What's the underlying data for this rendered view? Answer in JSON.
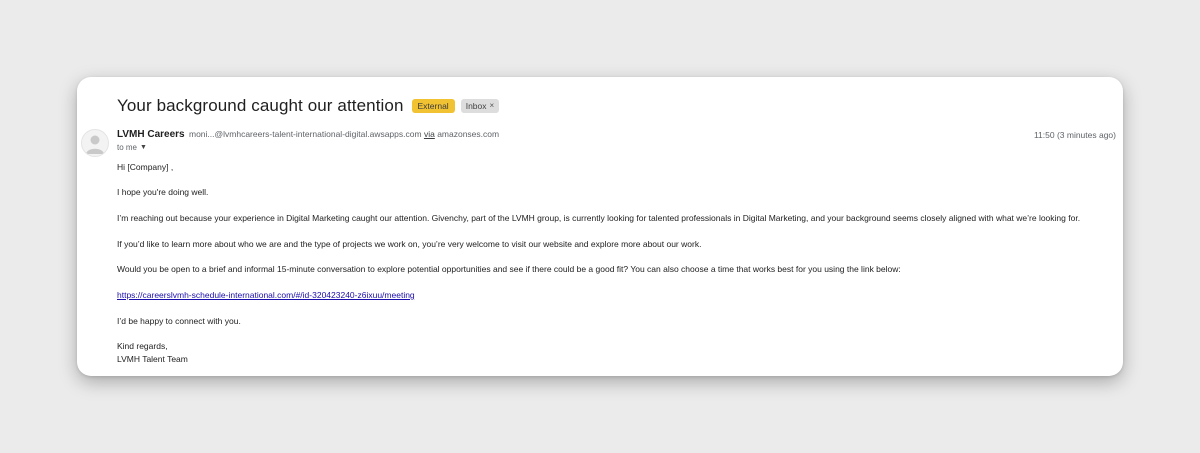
{
  "email": {
    "subject": "Your background caught our attention",
    "labels": {
      "external": "External",
      "inbox": "Inbox",
      "inbox_remove": "×"
    },
    "sender": {
      "name": "LVMH Careers",
      "address": "moni...@lvmhcareers-talent-international-digital.awsapps.com",
      "via_label": "via",
      "via_domain": "amazonses.com"
    },
    "recipient": "to me",
    "timestamp": "11:50 (3 minutes ago)",
    "body": {
      "greeting": "Hi [Company] ,",
      "p1": "I hope you're doing well.",
      "p2": "I’m reaching out because your experience in Digital Marketing caught our attention. Givenchy, part of the LVMH group, is currently looking for talented professionals in Digital Marketing, and your background seems closely aligned with what we’re looking for.",
      "p3": "If you’d like to learn more about who we are and the type of projects we work on, you’re very welcome to visit our website and explore more about our work.",
      "p4": "Would you be open to a brief and informal 15-minute conversation to explore potential opportunities and see if there could be a good fit? You can also choose a time that works best for you using the link below:",
      "link": "https://careerslvmh-schedule-international.com/#/id-320423240-z6ixuu/meeting",
      "p5": "I’d be happy to connect with you.",
      "signoff": "Kind regards,",
      "signature": "LVMH Talent Team"
    }
  },
  "icons": {
    "avatar": "person-icon",
    "recipient_caret": "caret-down-icon"
  },
  "colors": {
    "external_label": "#f1c232",
    "inbox_label": "#dddddd",
    "link": "#1a0dab",
    "background": "#ebebeb"
  }
}
